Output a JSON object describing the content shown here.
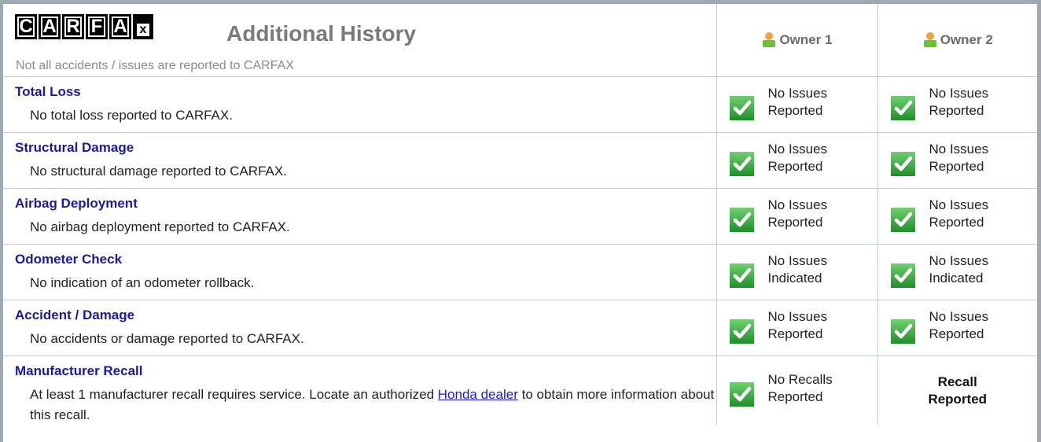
{
  "header": {
    "logo_letters": [
      "C",
      "A",
      "R",
      "F",
      "A",
      "x"
    ],
    "title": "Additional History",
    "subtitle": "Not all accidents / issues are reported to CARFAX",
    "owners": [
      "Owner 1",
      "Owner 2"
    ]
  },
  "rows": [
    {
      "title": "Total Loss",
      "desc": "No total loss reported to CARFAX.",
      "owner1": [
        "No Issues",
        "Reported"
      ],
      "owner2": [
        "No Issues",
        "Reported"
      ]
    },
    {
      "title": "Structural Damage",
      "desc": "No structural damage reported to CARFAX.",
      "owner1": [
        "No Issues",
        "Reported"
      ],
      "owner2": [
        "No Issues",
        "Reported"
      ]
    },
    {
      "title": "Airbag Deployment",
      "desc": "No airbag deployment reported to CARFAX.",
      "owner1": [
        "No Issues",
        "Reported"
      ],
      "owner2": [
        "No Issues",
        "Reported"
      ]
    },
    {
      "title": "Odometer Check",
      "desc": "No indication of an odometer rollback.",
      "owner1": [
        "No Issues",
        "Indicated"
      ],
      "owner2": [
        "No Issues",
        "Indicated"
      ]
    },
    {
      "title": "Accident / Damage",
      "desc": "No accidents or damage reported to CARFAX.",
      "owner1": [
        "No Issues",
        "Reported"
      ],
      "owner2": [
        "No Issues",
        "Reported"
      ]
    },
    {
      "title": "Manufacturer Recall",
      "desc_before": "At least 1 manufacturer recall requires service. Locate an authorized",
      "desc_link": "Honda dealer",
      "desc_after": "to obtain more information about this recall.",
      "owner1": [
        "No Recalls",
        "Reported"
      ],
      "owner2": [
        "Recall",
        "Reported"
      ]
    }
  ],
  "colors": {
    "frame": "#9fa8b3",
    "link": "#1a1aa0",
    "check_green": "#3aa33a"
  },
  "icons": {
    "owner": "person-icon",
    "ok": "checkmark-icon"
  }
}
